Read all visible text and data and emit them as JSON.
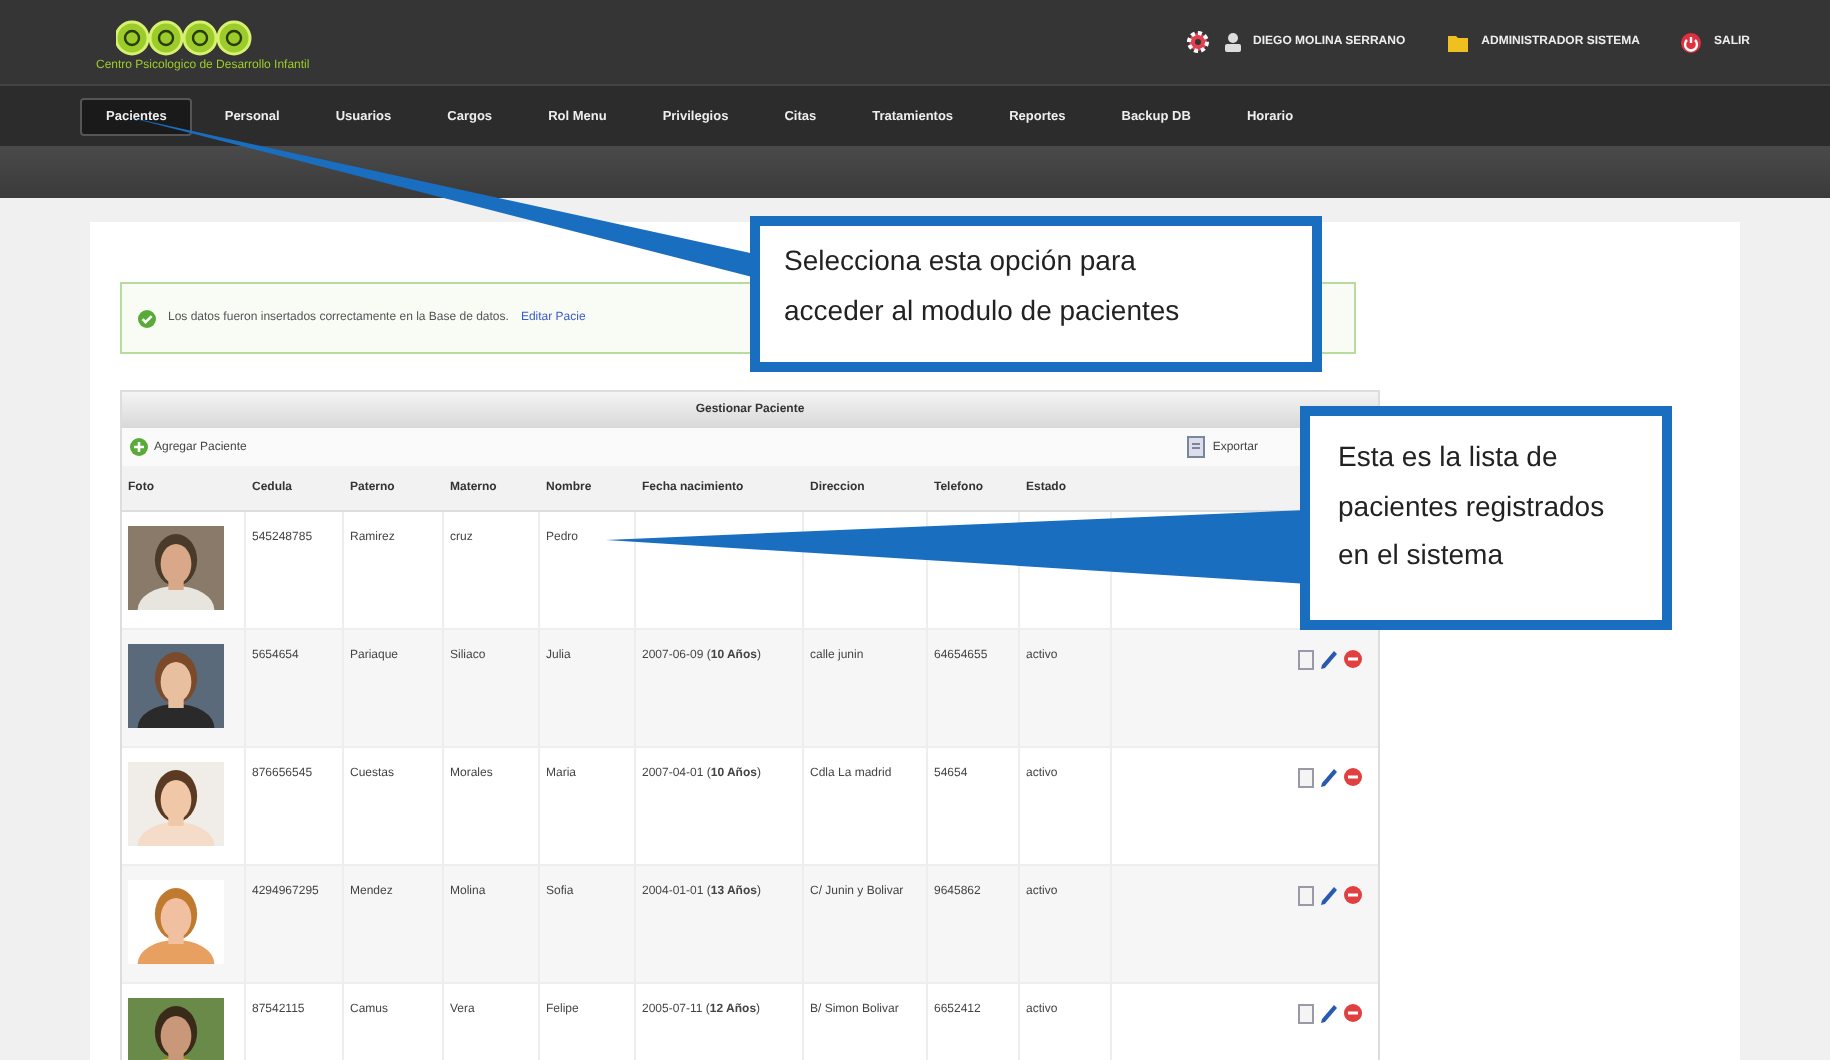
{
  "header": {
    "logo_text": "Centro Psicologico de Desarrollo Infantil",
    "user": "DIEGO MOLINA SERRANO",
    "role": "ADMINISTRADOR SISTEMA",
    "logout": "SALIR"
  },
  "nav": [
    {
      "label": "Pacientes",
      "selected": true
    },
    {
      "label": "Personal",
      "selected": false
    },
    {
      "label": "Usuarios",
      "selected": false
    },
    {
      "label": "Cargos",
      "selected": false
    },
    {
      "label": "Rol Menu",
      "selected": false
    },
    {
      "label": "Privilegios",
      "selected": false
    },
    {
      "label": "Citas",
      "selected": false
    },
    {
      "label": "Tratamientos",
      "selected": false
    },
    {
      "label": "Reportes",
      "selected": false
    },
    {
      "label": "Backup DB",
      "selected": false
    },
    {
      "label": "Horario",
      "selected": false
    }
  ],
  "message": {
    "text": "Los datos fueron insertados correctamente en la Base de datos.",
    "link": "Editar Pacie"
  },
  "panel": {
    "title": "Gestionar Paciente",
    "add": "Agregar Paciente",
    "export": "Exportar"
  },
  "table": {
    "columns": [
      "Foto",
      "Cedula",
      "Paterno",
      "Materno",
      "Nombre",
      "Fecha nacimiento",
      "Direccion",
      "Telefono",
      "Estado"
    ],
    "rows": [
      {
        "cedula": "545248785",
        "paterno": "Ramirez",
        "materno": "cruz",
        "nombre": "Pedro"
      },
      {
        "cedula": "5654654",
        "paterno": "Pariaque",
        "materno": "Siliaco",
        "nombre": "Julia",
        "fecha": "2007-06-09 (**10 Años**)",
        "direccion": "calle junin",
        "telefono": "64654655",
        "estado": "activo"
      },
      {
        "cedula": "876656545",
        "paterno": "Cuestas",
        "materno": "Morales",
        "nombre": "Maria",
        "fecha": "2007-04-01 (**10 Años**)",
        "direccion": "Cdla La madrid",
        "telefono": "54654",
        "estado": "activo"
      },
      {
        "cedula": "4294967295",
        "paterno": "Mendez",
        "materno": "Molina",
        "nombre": "Sofia",
        "fecha": "2004-01-01 (**13 Años**)",
        "direccion": "C/ Junin y Bolivar",
        "telefono": "9645862",
        "estado": "activo"
      },
      {
        "cedula": "87542115",
        "paterno": "Camus",
        "materno": "Vera",
        "nombre": "Felipe",
        "fecha": "2005-07-11 (**12 Años**)",
        "direccion": "B/ Simon Bolivar",
        "telefono": "6652412",
        "estado": "activo"
      }
    ]
  },
  "callouts": [
    "Selecciona esta opción para acceder al modulo de pacientes",
    "Esta es la lista de pacientes registrados en el sistema"
  ]
}
